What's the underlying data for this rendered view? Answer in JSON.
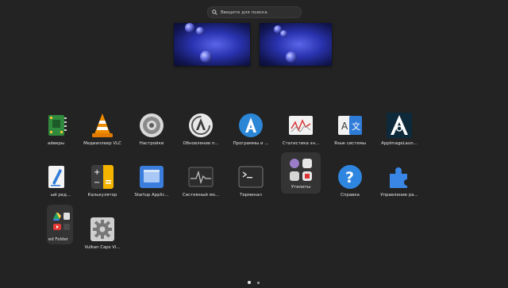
{
  "search": {
    "placeholder": "Введите для поиска"
  },
  "workspaces": [
    "workspace-1",
    "workspace-2"
  ],
  "apps": {
    "row1": [
      {
        "label": "айверы"
      },
      {
        "label": "Медиаплеер VLC"
      },
      {
        "label": "Настройки"
      },
      {
        "label": "Обновление п..."
      },
      {
        "label": "Программы и ..."
      },
      {
        "label": "Статистика эн..."
      },
      {
        "label": "Язык системы"
      },
      {
        "label": "AppImageLaun..."
      }
    ],
    "row2": [
      {
        "label": "ый ред..."
      },
      {
        "label": "Калькулятор"
      },
      {
        "label": "Startup Applic..."
      },
      {
        "label": "Системный мо..."
      },
      {
        "label": "Терминал"
      },
      {
        "label": "Утилиты"
      },
      {
        "label": "Справка"
      },
      {
        "label": "Управление ра..."
      }
    ],
    "row3": [
      {
        "label": "ed Folder"
      },
      {
        "label": "Vulkan Caps Vi..."
      }
    ]
  },
  "icons": {
    "drivers": "chip-icon",
    "vlc": "vlc-cone-icon",
    "settings": "gear-icon",
    "updates": "update-icon",
    "software": "software-store-icon",
    "power_stats": "power-statistics-icon",
    "language": "language-icon",
    "appimage": "appimage-launcher-icon",
    "editor": "text-editor-icon",
    "calculator": "calculator-icon",
    "startup": "startup-applications-icon",
    "sysmon": "system-monitor-icon",
    "terminal": "terminal-icon",
    "utilities": "folder-icon",
    "help": "help-icon",
    "extensions": "extensions-icon",
    "shared_folder": "folder-icon",
    "vulkan": "gear-icon"
  },
  "colors": {
    "background": "#232323",
    "accent": "#3584e4"
  },
  "pager": {
    "pages": 2,
    "current": 1
  }
}
